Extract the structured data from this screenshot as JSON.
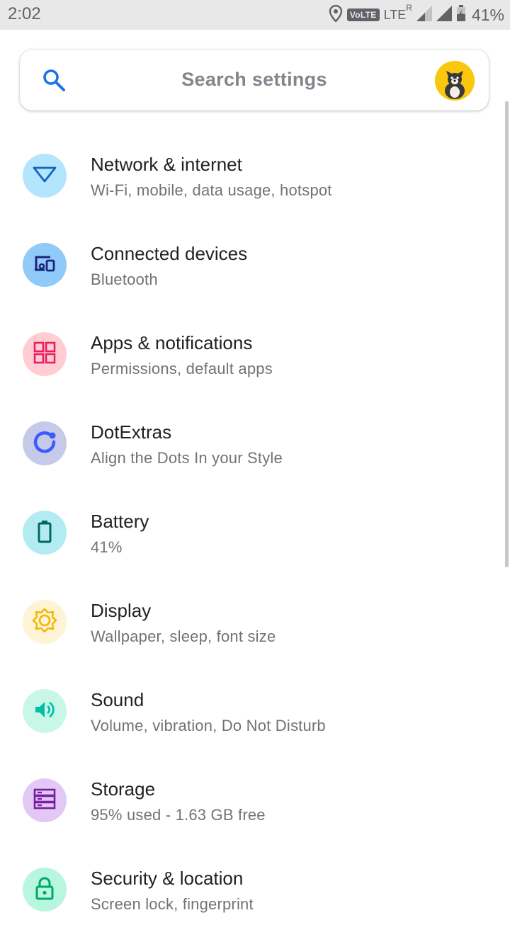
{
  "status_bar": {
    "time": "2:02",
    "volte": "VoLTE",
    "network": "LTE",
    "roaming": "R",
    "battery": "41%"
  },
  "search": {
    "placeholder": "Search settings"
  },
  "settings": [
    {
      "title": "Network & internet",
      "subtitle": "Wi-Fi, mobile, data usage, hotspot",
      "icon": "wifi-icon",
      "bg": "#b3e5fc",
      "fg": "#1565c0"
    },
    {
      "title": "Connected devices",
      "subtitle": "Bluetooth",
      "icon": "devices-icon",
      "bg": "#90caf9",
      "fg": "#1a237e"
    },
    {
      "title": "Apps & notifications",
      "subtitle": "Permissions, default apps",
      "icon": "apps-grid-icon",
      "bg": "#ffcdd2",
      "fg": "#e91e63"
    },
    {
      "title": "DotExtras",
      "subtitle": "Align the Dots In your Style",
      "icon": "dot-ring-icon",
      "bg": "#c5cae9",
      "fg": "#3d5afe"
    },
    {
      "title": "Battery",
      "subtitle": "41%",
      "icon": "battery-icon",
      "bg": "#b2ebf2",
      "fg": "#00695c"
    },
    {
      "title": "Display",
      "subtitle": "Wallpaper, sleep, font size",
      "icon": "brightness-icon",
      "bg": "#fff3d6",
      "fg": "#f4b400"
    },
    {
      "title": "Sound",
      "subtitle": "Volume, vibration, Do Not Disturb",
      "icon": "volume-icon",
      "bg": "#c8f7e8",
      "fg": "#00bfa5"
    },
    {
      "title": "Storage",
      "subtitle": "95% used - 1.63 GB free",
      "icon": "storage-icon",
      "bg": "#e1c8f5",
      "fg": "#7b1fa2"
    },
    {
      "title": "Security & location",
      "subtitle": "Screen lock, fingerprint",
      "icon": "lock-icon",
      "bg": "#b9f6e0",
      "fg": "#00a86b"
    }
  ]
}
